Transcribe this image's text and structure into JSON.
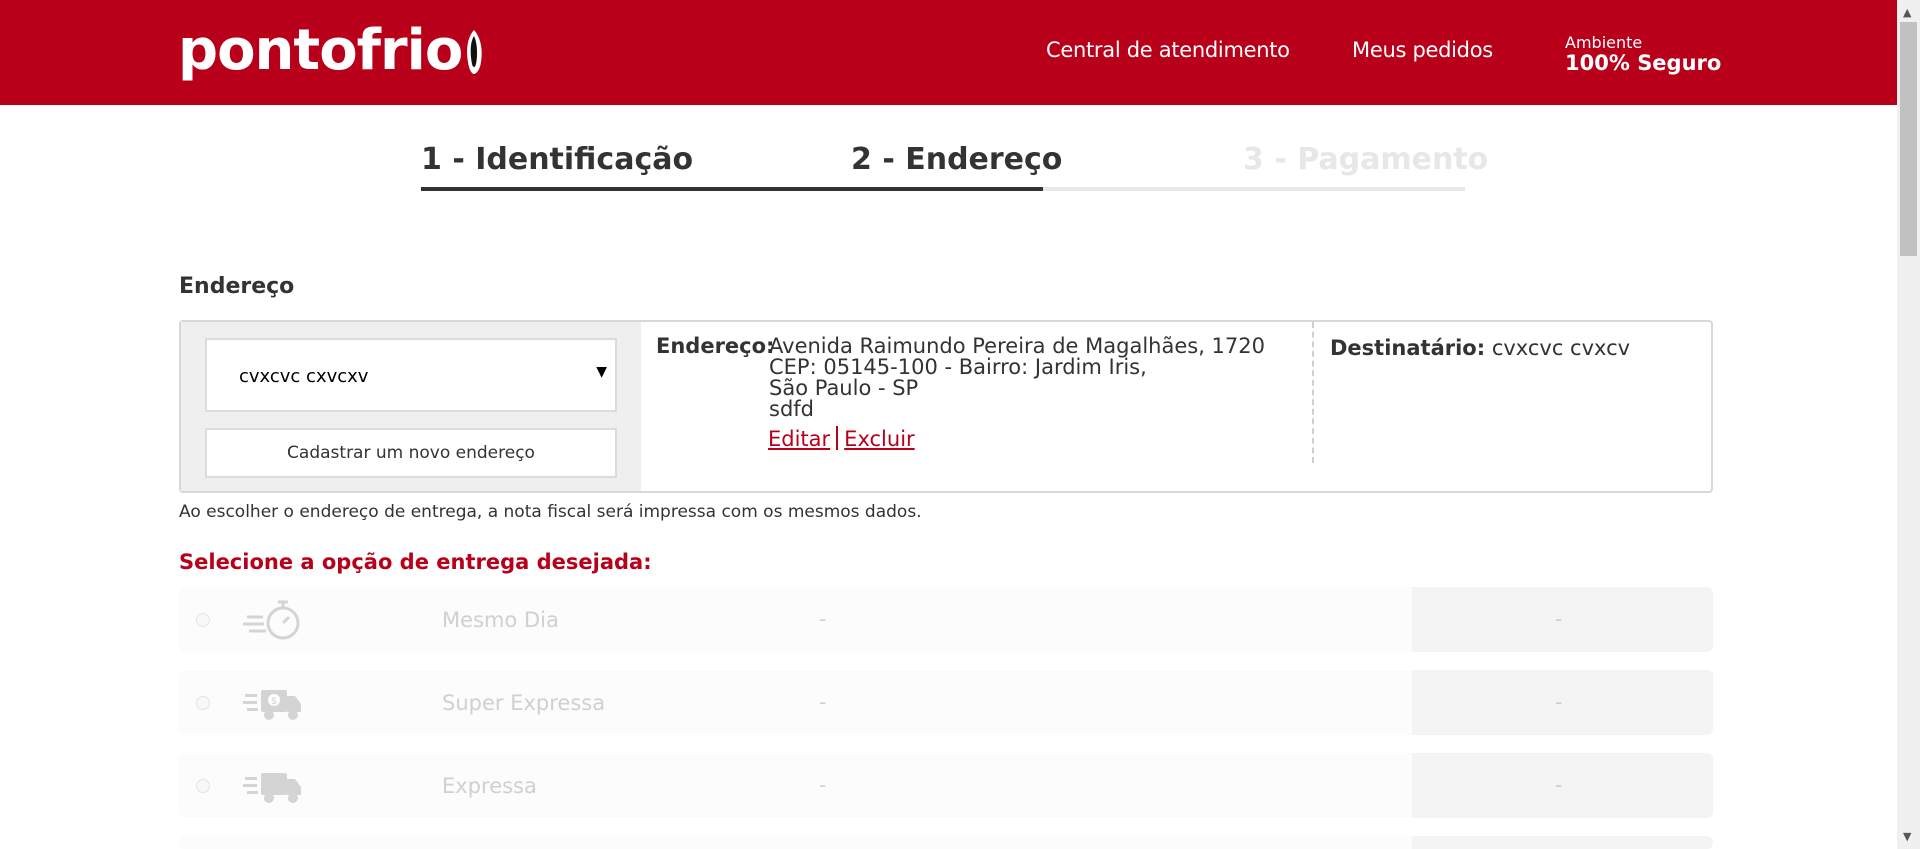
{
  "header": {
    "logo_text": "pontofrio",
    "links": [
      "Central de atendimento",
      "Meus pedidos"
    ],
    "secure_line1": "Ambiente",
    "secure_line2": "100% Seguro",
    "brand_color": "#b9001a"
  },
  "steps": [
    {
      "label": "1 - Identificação",
      "state": "done"
    },
    {
      "label": "2 - Endereço",
      "state": "active"
    },
    {
      "label": "3 - Pagamento",
      "state": "inactive"
    }
  ],
  "progress_fraction": 0.6,
  "address": {
    "section_title": "Endereço",
    "selected": "cvxcvc cxvcxv",
    "new_address_button": "Cadastrar um novo endereço",
    "label": "Endereço:",
    "lines": [
      "Avenida Raimundo Pereira de Magalhães, 1720",
      "CEP: 05145-100 - Bairro: Jardim Iris,",
      "São Paulo - SP",
      "sdfd"
    ],
    "edit_link": "Editar",
    "delete_link": "Excluir",
    "recipient_label": "Destinatário:",
    "recipient": "cvxcvc cvxcv",
    "note": "Ao escolher o endereço de entrega, a nota fiscal será impressa com os mesmos dados."
  },
  "shipping": {
    "title": "Selecione a opção de entrega desejada:",
    "options": [
      {
        "name": "Mesmo Dia",
        "detail": "-",
        "price": "-",
        "icon": "stopwatch-icon"
      },
      {
        "name": "Super Expressa",
        "detail": "-",
        "price": "-",
        "icon": "money-truck-icon"
      },
      {
        "name": "Expressa",
        "detail": "-",
        "price": "-",
        "icon": "fast-truck-icon"
      }
    ]
  }
}
